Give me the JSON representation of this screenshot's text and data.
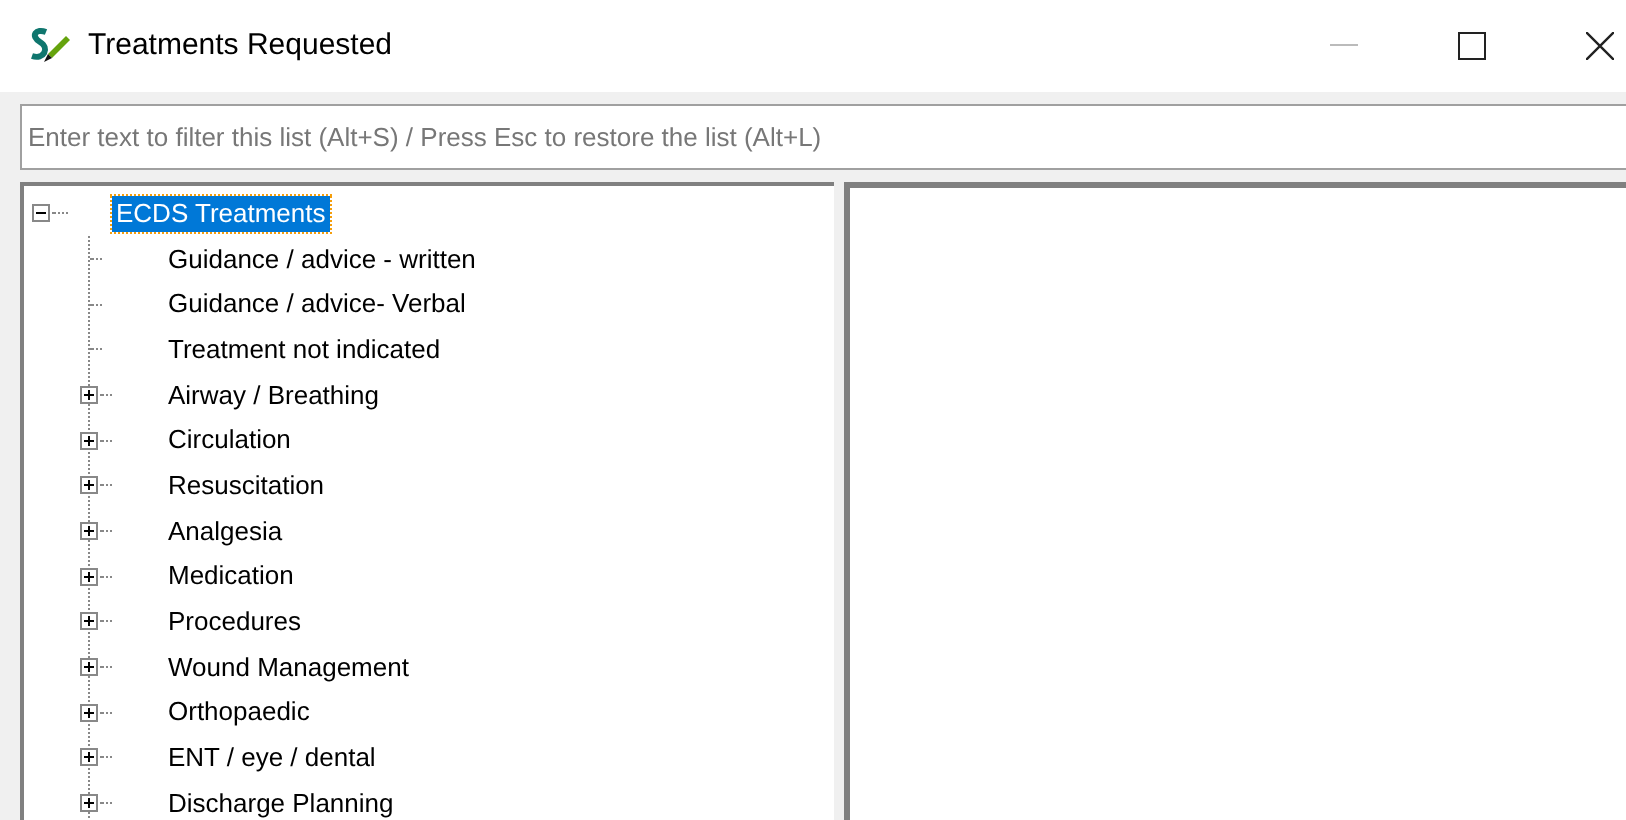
{
  "window": {
    "title": "Treatments Requested"
  },
  "filter": {
    "placeholder": "Enter text to filter this list (Alt+S) / Press Esc to restore the list (Alt+L)"
  },
  "tree": {
    "label": "ECDS Treatments",
    "expanded": true,
    "selected": true,
    "children": [
      {
        "label": "Guidance / advice - written",
        "kind": "leaf",
        "selected": false
      },
      {
        "label": "Guidance / advice- Verbal",
        "kind": "leaf",
        "selected": false
      },
      {
        "label": "Treatment not indicated",
        "kind": "leaf",
        "selected": false
      },
      {
        "label": "Airway / Breathing",
        "kind": "group",
        "selected": false
      },
      {
        "label": "Circulation",
        "kind": "group",
        "selected": false
      },
      {
        "label": "Resuscitation",
        "kind": "group",
        "selected": false
      },
      {
        "label": "Analgesia",
        "kind": "group",
        "selected": false
      },
      {
        "label": "Medication",
        "kind": "group",
        "selected": false
      },
      {
        "label": "Procedures",
        "kind": "group",
        "selected": false
      },
      {
        "label": "Wound Management",
        "kind": "group",
        "selected": false
      },
      {
        "label": "Orthopaedic",
        "kind": "group",
        "selected": false
      },
      {
        "label": "ENT / eye / dental",
        "kind": "group",
        "selected": false
      },
      {
        "label": "Discharge Planning",
        "kind": "group",
        "selected": false
      }
    ]
  }
}
